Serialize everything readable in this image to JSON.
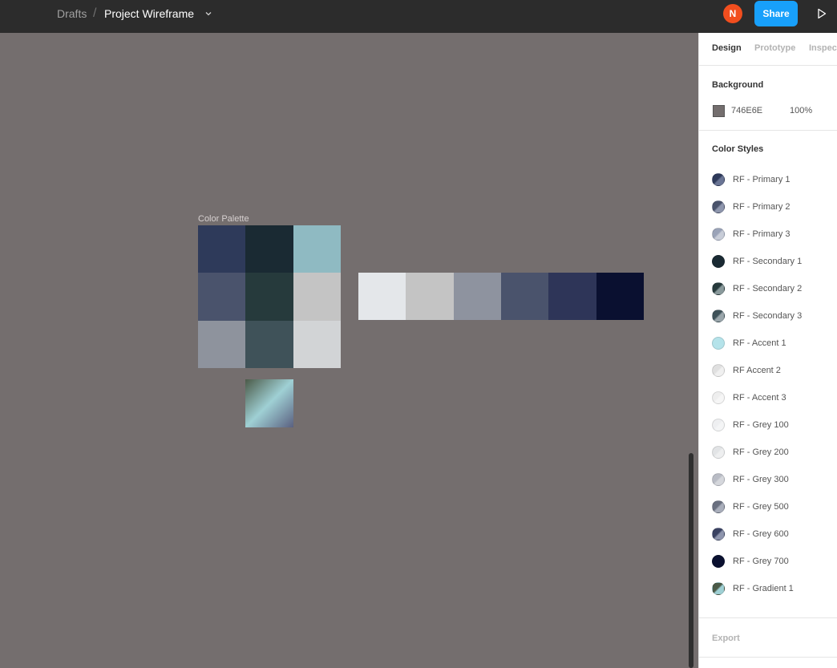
{
  "topbar": {
    "breadcrumb_root": "Drafts",
    "breadcrumb_separator": "/",
    "file_name": "Project Wireframe",
    "avatar_initial": "N",
    "share_label": "Share",
    "icons": [
      "chevron-down-icon",
      "play-icon"
    ],
    "colors": {
      "bar": "#2c2c2c",
      "share": "#18a0fb",
      "avatar": "#f24e1e"
    }
  },
  "canvas": {
    "background": "#746e6e",
    "frame_label": "Color Palette",
    "grid_colors": [
      "#2e3a5a",
      "#1a2a33",
      "#8fbac2",
      "#4a536c",
      "#263a3c",
      "#c4c4c4",
      "#8e939d",
      "#3f5259",
      "#d2d4d6"
    ],
    "strip_colors": [
      "#e4e7ea",
      "#c4c4c4",
      "#8e939f",
      "#4a536c",
      "#2e3558",
      "#0a1030"
    ],
    "gradient_colors": [
      "#4b5a48",
      "#9fd0d4",
      "#5a6080"
    ]
  },
  "panel": {
    "tabs": [
      {
        "label": "Design",
        "active": true
      },
      {
        "label": "Prototype",
        "active": false
      },
      {
        "label": "Inspect",
        "active": false
      }
    ],
    "background_title": "Background",
    "background_hex": "746E6E",
    "background_opacity": "100%",
    "color_styles_title": "Color Styles",
    "color_styles": [
      {
        "label": "RF - Primary 1",
        "color": "#2e3a5a",
        "color2": "#6a7595"
      },
      {
        "label": "RF - Primary 2",
        "color": "#4a536c",
        "color2": "#8e96ad"
      },
      {
        "label": "RF - Primary 3",
        "color": "#9aa3b8",
        "color2": "#c8cdd8"
      },
      {
        "label": "RF - Secondary 1",
        "color": "#1a2a33",
        "color2": "#1a2a33"
      },
      {
        "label": "RF - Secondary 2",
        "color": "#263a3c",
        "color2": "#8a9a9c"
      },
      {
        "label": "RF - Secondary 3",
        "color": "#3f5259",
        "color2": "#9aa6ab"
      },
      {
        "label": "RF - Accent 1",
        "color": "#b5e3ea",
        "color2": "#b5e3ea"
      },
      {
        "label": "RF Accent 2",
        "color": "#e0e0e0",
        "color2": "#f0f0f0"
      },
      {
        "label": "RF - Accent 3",
        "color": "#eeeeee",
        "color2": "#f6f6f6"
      },
      {
        "label": "RF - Grey 100",
        "color": "#eeeff1",
        "color2": "#f4f5f6"
      },
      {
        "label": "RF - Grey 200",
        "color": "#e2e4e6",
        "color2": "#eeeff0"
      },
      {
        "label": "RF - Grey 300",
        "color": "#b9bcc5",
        "color2": "#d5d7dc"
      },
      {
        "label": "RF - Grey 500",
        "color": "#6a7080",
        "color2": "#a9aebb"
      },
      {
        "label": "RF - Grey 600",
        "color": "#3a4262",
        "color2": "#8e95ad"
      },
      {
        "label": "RF - Grey 700",
        "color": "#0a1030",
        "color2": "#0a1030"
      },
      {
        "label": "RF - Gradient 1",
        "color": "#4b5a48",
        "color2": "#9fd0d4"
      }
    ],
    "export_title": "Export"
  }
}
